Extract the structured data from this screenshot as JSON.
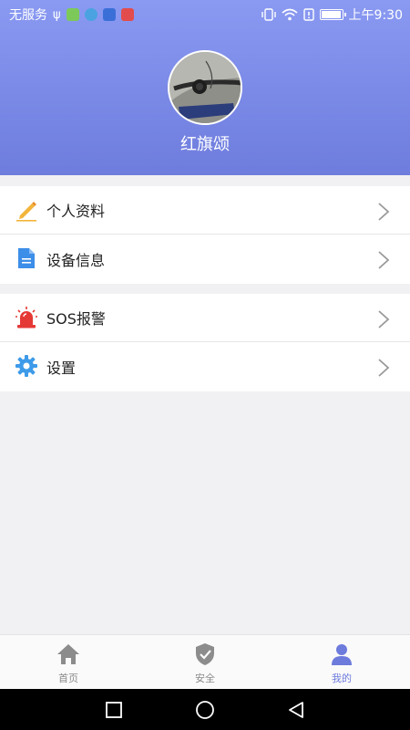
{
  "status_bar": {
    "carrier": "无服务",
    "time": "上午9:30",
    "battery_level": 0.9
  },
  "profile": {
    "name": "红旗颂"
  },
  "menu": {
    "group1": [
      {
        "label": "个人资料",
        "icon": "pencil-icon"
      },
      {
        "label": "设备信息",
        "icon": "document-icon"
      }
    ],
    "group2": [
      {
        "label": "SOS报警",
        "icon": "alarm-siren-icon"
      },
      {
        "label": "设置",
        "icon": "gear-icon"
      }
    ]
  },
  "tabs": [
    {
      "label": "首页",
      "icon": "home-icon",
      "active": false
    },
    {
      "label": "安全",
      "icon": "shield-icon",
      "active": false
    },
    {
      "label": "我的",
      "icon": "person-icon",
      "active": true
    }
  ],
  "colors": {
    "accent": "#6d7bdc",
    "header_top": "#8a9af2",
    "header_bottom": "#6e7ddd"
  }
}
